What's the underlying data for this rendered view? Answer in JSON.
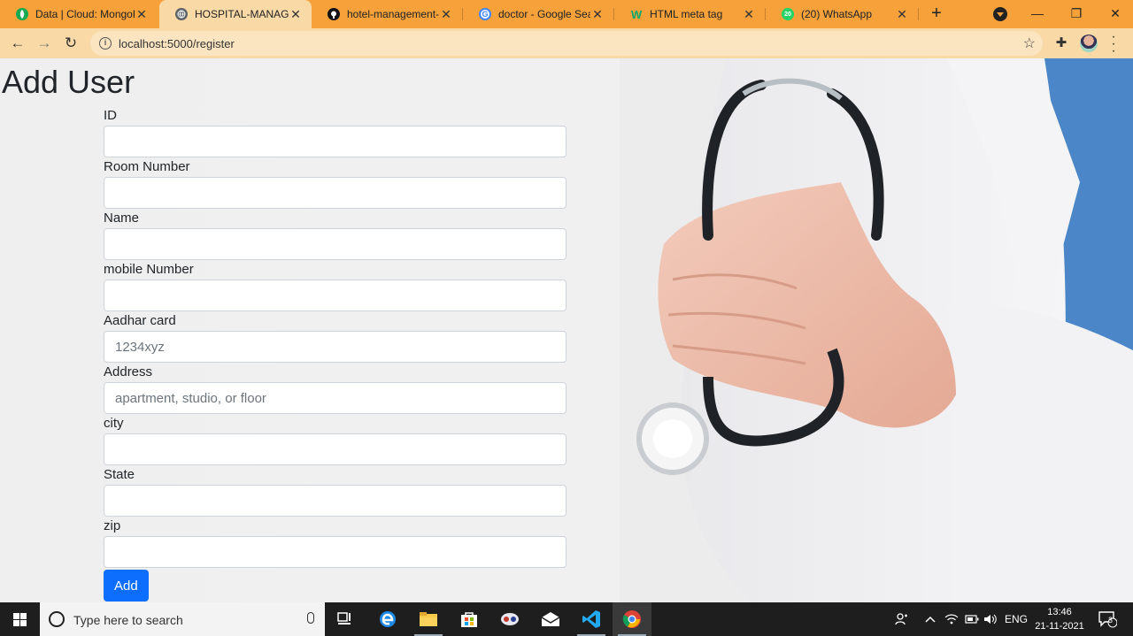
{
  "browser": {
    "tabs": [
      {
        "title": "Data | Cloud: MongoD",
        "favicon": "mongodb-leaf-icon",
        "favicon_color": "#13aa52"
      },
      {
        "title": "HOSPITAL-MANAGEM",
        "favicon": "globe-icon",
        "favicon_color": "#5f6368"
      },
      {
        "title": "hotel-management-sy",
        "favicon": "github-icon",
        "favicon_color": "#111111"
      },
      {
        "title": "doctor - Google Searc",
        "favicon": "google-icon",
        "favicon_color": "#4285f4"
      },
      {
        "title": "HTML meta tag",
        "favicon": "w3schools-icon",
        "favicon_color": "#04aa6d"
      },
      {
        "title": "(20) WhatsApp",
        "favicon": "whatsapp-icon",
        "favicon_color": "#25d366",
        "badge": "20"
      }
    ],
    "active_tab": 1,
    "url": "localhost:5000/register",
    "frame_color": "#f6a13a",
    "toolbar_color": "#f9d9a6"
  },
  "page": {
    "title": "Add User",
    "fields": [
      {
        "label": "ID",
        "placeholder": "",
        "name": "id-field"
      },
      {
        "label": "Room Number",
        "placeholder": "",
        "name": "room-number-field"
      },
      {
        "label": "Name",
        "placeholder": "",
        "name": "name-field"
      },
      {
        "label": "mobile Number",
        "placeholder": "",
        "name": "mobile-number-field"
      },
      {
        "label": "Aadhar card",
        "placeholder": "1234xyz",
        "name": "aadhar-card-field"
      },
      {
        "label": "Address",
        "placeholder": "apartment, studio, or floor",
        "name": "address-field"
      },
      {
        "label": "city",
        "placeholder": "",
        "name": "city-field"
      },
      {
        "label": "State",
        "placeholder": "",
        "name": "state-field"
      },
      {
        "label": "zip",
        "placeholder": "",
        "name": "zip-field"
      }
    ],
    "submit_label": "Add",
    "accent_color": "#0d6efd"
  },
  "taskbar": {
    "search_placeholder": "Type here to search",
    "apps": [
      "task-view-icon",
      "edge-icon",
      "file-explorer-icon",
      "store-icon",
      "snip-icon",
      "mail-icon",
      "vscode-icon",
      "chrome-icon"
    ],
    "language": "ENG",
    "time": "13:46",
    "date": "21-11-2021",
    "notification_count": "3"
  }
}
